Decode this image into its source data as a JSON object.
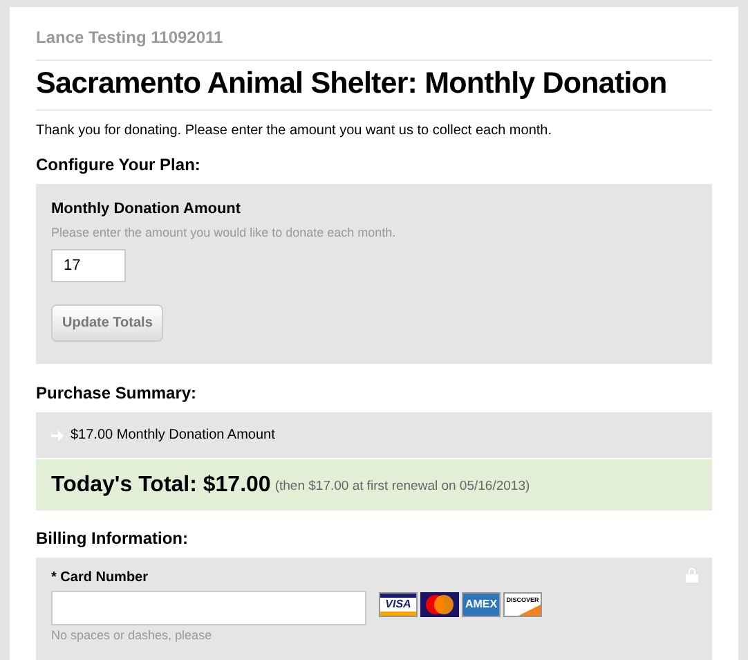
{
  "account": "Lance Testing 11092011",
  "title": "Sacramento Animal Shelter: Monthly Donation",
  "intro": "Thank you for donating. Please enter the amount you want us to collect each month.",
  "configure": {
    "heading": "Configure Your Plan:",
    "label": "Monthly Donation Amount",
    "hint": "Please enter the amount you would like to donate each month.",
    "value": "17",
    "button": "Update Totals"
  },
  "summary": {
    "heading": "Purchase Summary:",
    "items": [
      "$17.00 Monthly Donation Amount"
    ],
    "total": "Today's Total: $17.00",
    "note": "(then $17.00 at first renewal on 05/16/2013)"
  },
  "billing": {
    "heading": "Billing Information:",
    "label": "* Card Number",
    "hint": "No spaces or dashes, please",
    "cards": [
      {
        "kind": "visa",
        "label": "VISA"
      },
      {
        "kind": "mastercard"
      },
      {
        "kind": "amex",
        "label": "AMEX"
      },
      {
        "kind": "discover",
        "label": "DISCOVER"
      }
    ]
  }
}
